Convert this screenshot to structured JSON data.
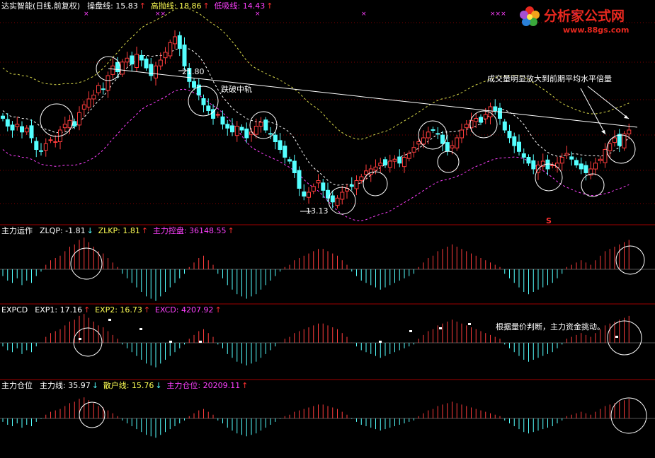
{
  "colors": {
    "background": "#000000",
    "up": "#ff3c3c",
    "down": "#54ffff",
    "white": "#ffffff",
    "yellow": "#ffff54",
    "magenta": "#ff40ff",
    "grid": "#7f0000",
    "arrow_up": "#ff3030",
    "arrow_down": "#54ffff",
    "logo_red": "#e8281f"
  },
  "logo": {
    "name": "分析家公式网",
    "url": "www.88gs.com",
    "icon": "flower-icon"
  },
  "panels": [
    {
      "id": "price",
      "header": [
        {
          "text": "达实智能(日线,前复权)",
          "color": "#ffffff",
          "arrow": ""
        },
        {
          "text": "操盘线: 15.83",
          "color": "#ffffff",
          "arrow": "up"
        },
        {
          "text": "高抛线: 18.86",
          "color": "#ffff54",
          "arrow": "up"
        },
        {
          "text": "低吸线: 14.43",
          "color": "#ff40ff",
          "arrow": "up"
        }
      ]
    },
    {
      "id": "zlyz",
      "header": [
        {
          "text": "主力运作",
          "color": "#ffffff",
          "arrow": ""
        },
        {
          "text": "ZLQP: -1.81",
          "color": "#ffffff",
          "arrow": "down"
        },
        {
          "text": "ZLKP: 1.81",
          "color": "#ffff54",
          "arrow": "up"
        },
        {
          "text": "主力控盘: 36148.55",
          "color": "#ff40ff",
          "arrow": "up"
        }
      ]
    },
    {
      "id": "expcd",
      "header": [
        {
          "text": "EXPCD",
          "color": "#ffffff",
          "arrow": ""
        },
        {
          "text": "EXP1: 17.16",
          "color": "#ffffff",
          "arrow": "up"
        },
        {
          "text": "EXP2: 16.73",
          "color": "#ffff54",
          "arrow": "up"
        },
        {
          "text": "EXCD: 4207.92",
          "color": "#ff40ff",
          "arrow": "up"
        }
      ]
    },
    {
      "id": "zlcw",
      "header": [
        {
          "text": "主力仓位",
          "color": "#ffffff",
          "arrow": ""
        },
        {
          "text": "主力线: 35.97",
          "color": "#ffffff",
          "arrow": "down"
        },
        {
          "text": "散户线: 15.76",
          "color": "#ffff54",
          "arrow": "down"
        },
        {
          "text": "主力仓位: 20209.11",
          "color": "#ff40ff",
          "arrow": "up"
        }
      ]
    }
  ],
  "annotations": {
    "high_price": "21.80",
    "low_price": "13.13",
    "break_mid": "跌破中轨",
    "volume_note": "成交量明显放大到前期平均水平倍量",
    "expcd_note": "根据量价判断，主力资金挑动。",
    "signal_s": "S",
    "x_marks": [
      "×",
      "××",
      "×",
      "×",
      "×××",
      "×"
    ]
  },
  "chart_data": {
    "type": "candlestick",
    "title": "达实智能(日线,前复权)",
    "annotated_high": 21.8,
    "annotated_low": 13.13,
    "close": [
      17.6,
      17.2,
      17.0,
      17.3,
      16.9,
      17.1,
      16.6,
      16.0,
      15.9,
      16.3,
      16.5,
      16.4,
      17.0,
      17.3,
      17.5,
      17.2,
      17.9,
      18.3,
      18.6,
      18.8,
      19.3,
      19.1,
      19.8,
      20.3,
      20.0,
      20.5,
      20.7,
      20.4,
      20.9,
      20.6,
      20.2,
      19.8,
      20.3,
      20.6,
      21.0,
      21.5,
      21.8,
      21.2,
      20.3,
      19.5,
      19.2,
      18.8,
      18.3,
      18.0,
      17.6,
      17.8,
      17.3,
      17.1,
      16.9,
      17.2,
      17.0,
      16.6,
      16.9,
      17.2,
      17.4,
      17.0,
      16.8,
      16.4,
      16.0,
      15.6,
      15.4,
      14.8,
      14.0,
      13.6,
      13.8,
      14.1,
      14.4,
      13.9,
      13.5,
      13.3,
      13.5,
      13.8,
      14.0,
      14.1,
      14.4,
      14.6,
      14.9,
      15.0,
      15.1,
      15.3,
      15.2,
      15.4,
      15.5,
      15.3,
      15.6,
      15.8,
      16.1,
      16.4,
      16.6,
      16.9,
      17.0,
      16.8,
      16.3,
      15.9,
      16.2,
      16.6,
      17.0,
      17.3,
      17.5,
      17.6,
      17.4,
      17.8,
      18.2,
      18.0,
      17.6,
      17.0,
      16.6,
      16.2,
      15.9,
      15.6,
      15.3,
      15.0,
      15.2,
      15.4,
      15.0,
      15.2,
      15.3,
      15.6,
      15.8,
      15.5,
      15.2,
      15.0,
      14.8,
      15.0,
      15.3,
      15.5,
      16.0,
      16.3,
      16.6,
      16.2,
      16.8,
      17.0
    ],
    "series": [
      {
        "name": "ZLKP",
        "values": [
          -3,
          -5,
          -6,
          -4,
          -7,
          -5,
          -6,
          -3,
          -1,
          2,
          4,
          5,
          6,
          8,
          10,
          11,
          13,
          14,
          12,
          10,
          8,
          7,
          5,
          3,
          1,
          -2,
          -4,
          -6,
          -8,
          -10,
          -12,
          -13,
          -14,
          -12,
          -10,
          -8,
          -6,
          -4,
          -2,
          1,
          3,
          5,
          6,
          4,
          2,
          -2,
          -4,
          -7,
          -9,
          -11,
          -12,
          -13,
          -12,
          -11,
          -9,
          -7,
          -5,
          -3,
          -1,
          1,
          2,
          4,
          5,
          6,
          7,
          8,
          9,
          9,
          8,
          7,
          6,
          4,
          2,
          -1,
          -3,
          -5,
          -6,
          -7,
          -8,
          -9,
          -8,
          -7,
          -6,
          -5,
          -4,
          -3,
          -2,
          1,
          3,
          5,
          6,
          8,
          9,
          10,
          11,
          10,
          9,
          8,
          7,
          6,
          5,
          4,
          3,
          2,
          1,
          -2,
          -4,
          -6,
          -8,
          -10,
          -11,
          -10,
          -9,
          -8,
          -7,
          -6,
          -4,
          -2,
          1,
          2,
          3,
          4,
          3,
          2,
          4,
          6,
          8,
          9,
          10,
          11,
          12,
          13
        ]
      }
    ]
  }
}
